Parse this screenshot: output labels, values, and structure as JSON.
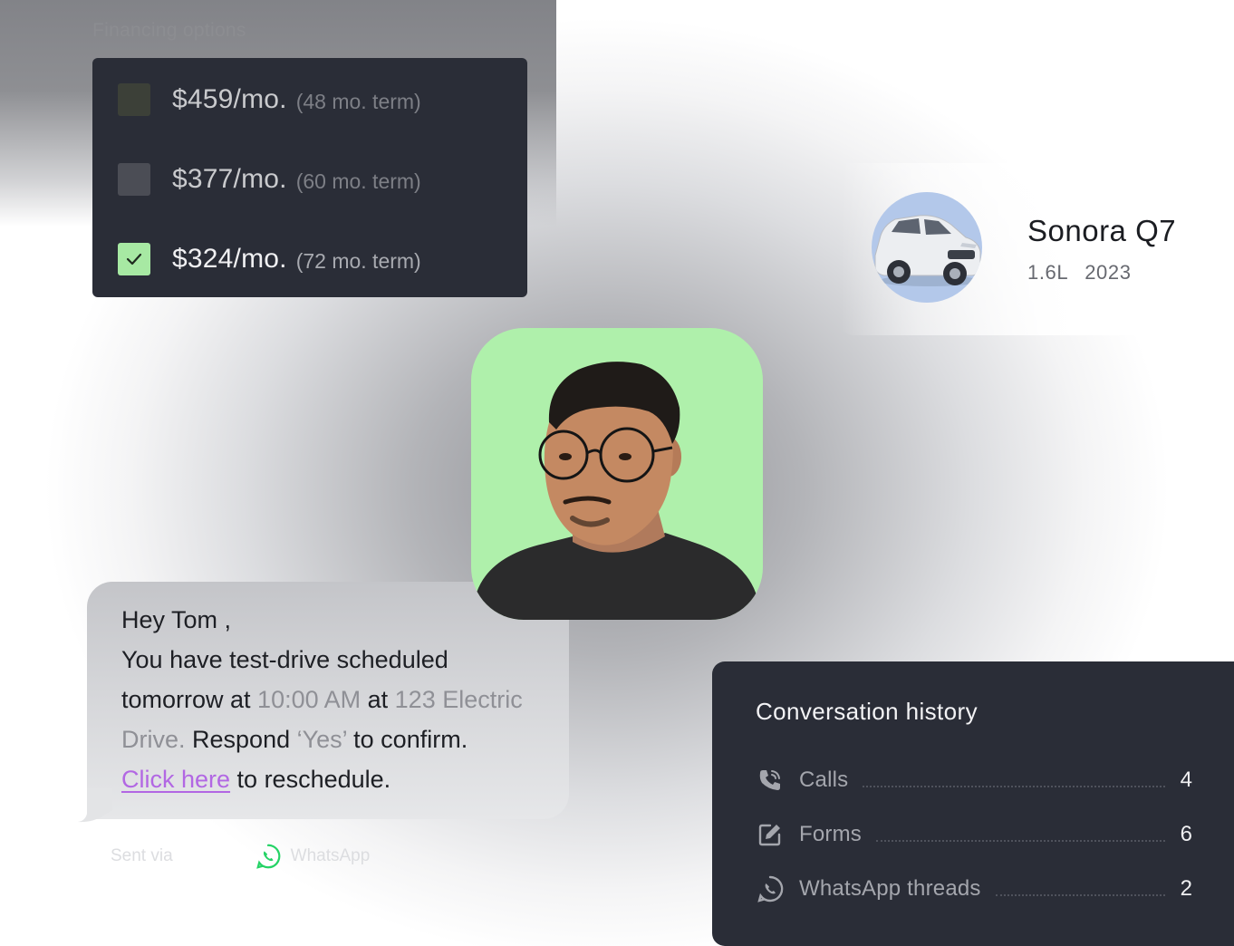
{
  "financing": {
    "title": "Financing options",
    "options": [
      {
        "price": "$459/mo.",
        "term": "(48 mo. term)",
        "selected": false
      },
      {
        "price": "$377/mo.",
        "term": "(60 mo. term)",
        "selected": false
      },
      {
        "price": "$324/mo.",
        "term": "(72 mo. term)",
        "selected": true
      }
    ]
  },
  "vehicle": {
    "name": "Sonora Q7",
    "engine": "1.6L",
    "year": "2023"
  },
  "message": {
    "greeting": "Hey Tom ,",
    "line_a": "You have test-drive scheduled",
    "line_b_start": "tomorrow at ",
    "time": "10:00 AM",
    "line_b_mid": " at ",
    "address_a": "123 Electric",
    "address_b": "Drive.",
    "line_c_mid": " Respond ",
    "confirm_word": "‘Yes’",
    "line_c_end": " to confirm.",
    "link_text": "Click here",
    "line_d_end": " to reschedule.",
    "sent_via": "Sent via",
    "channel": "WhatsApp"
  },
  "history": {
    "title": "Conversation history",
    "rows": [
      {
        "icon": "phone-icon",
        "label": "Calls",
        "count": "4"
      },
      {
        "icon": "form-edit-icon",
        "label": "Forms",
        "count": "6"
      },
      {
        "icon": "whatsapp-icon",
        "label": "WhatsApp threads",
        "count": "2"
      }
    ]
  },
  "colors": {
    "dark_card": "#2a2d37",
    "check_green": "#a7e9a3",
    "avatar_bg": "#aff0ab",
    "link_purple": "#b267e3",
    "whatsapp_green": "#25d366"
  }
}
